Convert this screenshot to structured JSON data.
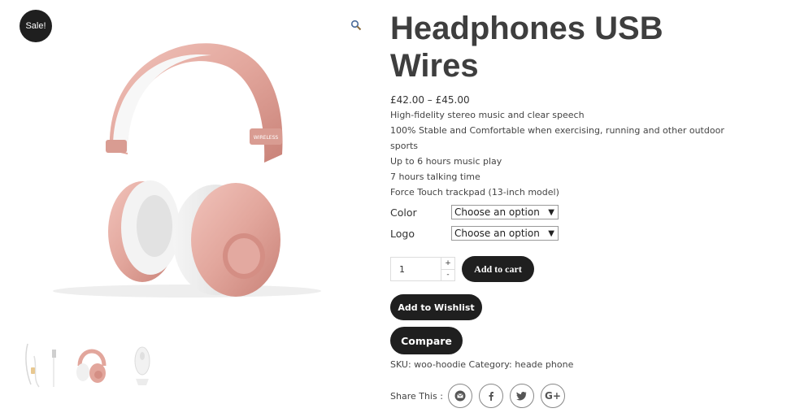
{
  "product": {
    "sale_badge": "Sale!",
    "title_line1": "Headphones USB",
    "title_line2": "Wires",
    "price_range": "£42.00 – £45.00",
    "features": [
      "High-fidelity stereo music and clear speech",
      "100% Stable and Comfortable when exercising, running and other outdoor",
      "sports",
      "Up to 6 hours music play",
      "7 hours talking time",
      "Force Touch trackpad (13-inch model)"
    ],
    "variations": [
      {
        "label": "Color",
        "selected": "Choose an option"
      },
      {
        "label": "Logo",
        "selected": "Choose an option"
      }
    ],
    "quantity": "1",
    "qty_plus": "+",
    "qty_minus": "-",
    "add_to_cart": "Add to cart",
    "add_to_wishlist": "Add to Wishlist",
    "compare": "Compare",
    "sku_label": "SKU:",
    "sku_value": "woo-hoodie",
    "category_label": "Category:",
    "category_value": "heade phone",
    "share_label": "Share This :",
    "share_icons": [
      "email-icon",
      "facebook-icon",
      "twitter-icon",
      "google-plus-icon"
    ],
    "image_brand_text": "WIRELESS",
    "colors": {
      "dark": "#1f1f1f",
      "rose_gold": "#e3a9a0",
      "white": "#ffffff"
    }
  }
}
